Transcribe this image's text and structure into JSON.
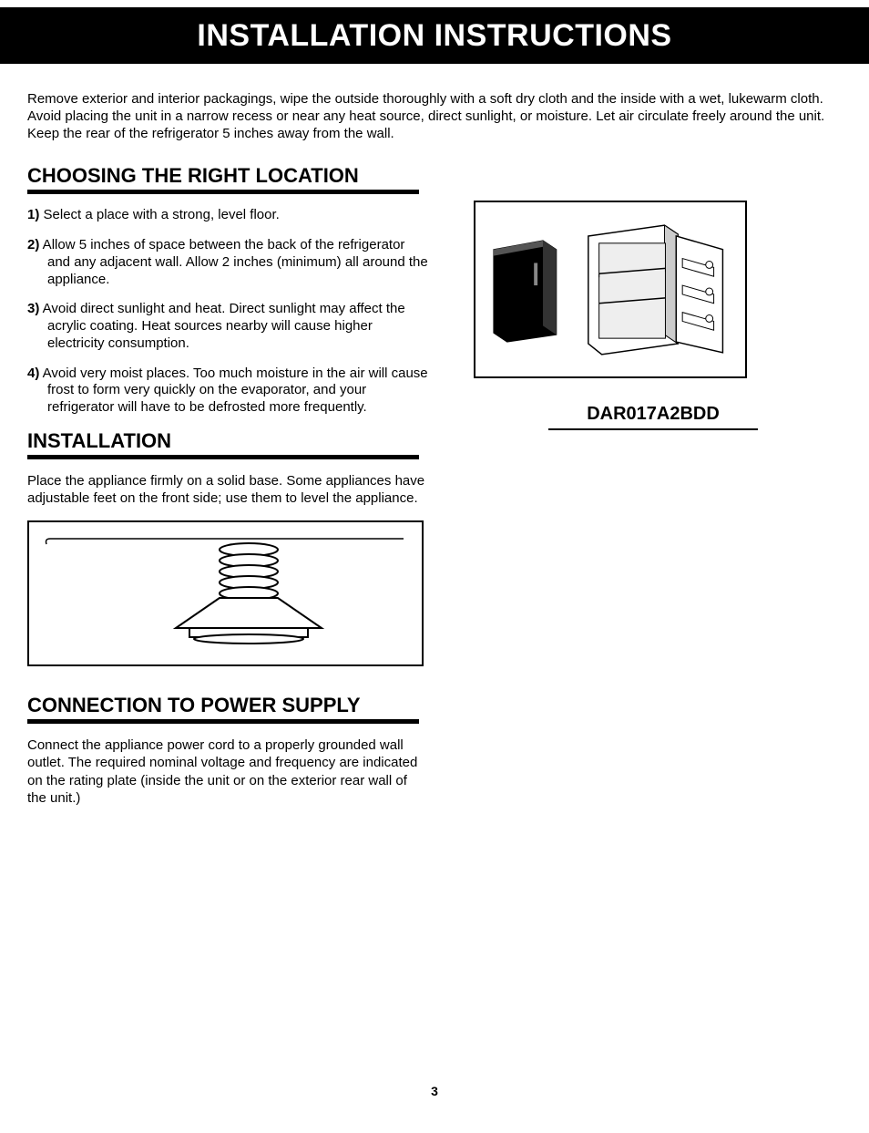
{
  "header": {
    "title": "INSTALLATION INSTRUCTIONS"
  },
  "intro": "Remove exterior and interior packagings, wipe the outside thoroughly with a soft dry cloth and the inside with a wet, lukewarm cloth.  Avoid placing the unit in a narrow recess or near any heat source, direct sunlight, or moisture.  Let air circulate freely around the unit.  Keep the rear of the refrigerator 5 inches away from the wall.",
  "sections": {
    "location": {
      "heading": "CHOOSING THE RIGHT LOCATION",
      "items": [
        {
          "num": "1)",
          "text": " Select a place with a strong, level floor."
        },
        {
          "num": "2)",
          "text": " Allow 5 inches of space between the back of the refrigerator and any adjacent wall. Allow 2 inches (minimum) all around the appliance."
        },
        {
          "num": "3)",
          "text": " Avoid direct sunlight and heat. Direct sunlight may affect the acrylic coating.  Heat sources nearby will cause higher electricity consumption."
        },
        {
          "num": "4)",
          "text": " Avoid very moist places. Too much moisture in the air will cause frost to form very quickly on the evaporator, and your refrigerator will have to be defrosted more frequently."
        }
      ]
    },
    "installation": {
      "heading": "INSTALLATION",
      "body": "Place the appliance firmly on a solid base. Some appliances have adjustable feet on the front side; use them to level the appliance."
    },
    "power": {
      "heading": "CONNECTION TO POWER SUPPLY",
      "body": "Connect the appliance power cord to a properly grounded wall outlet. The required nominal voltage and frequency are indicated on the rating plate (inside the unit or on the exterior rear wall of the unit.)"
    }
  },
  "model": "DAR017A2BDD",
  "page_number": "3"
}
